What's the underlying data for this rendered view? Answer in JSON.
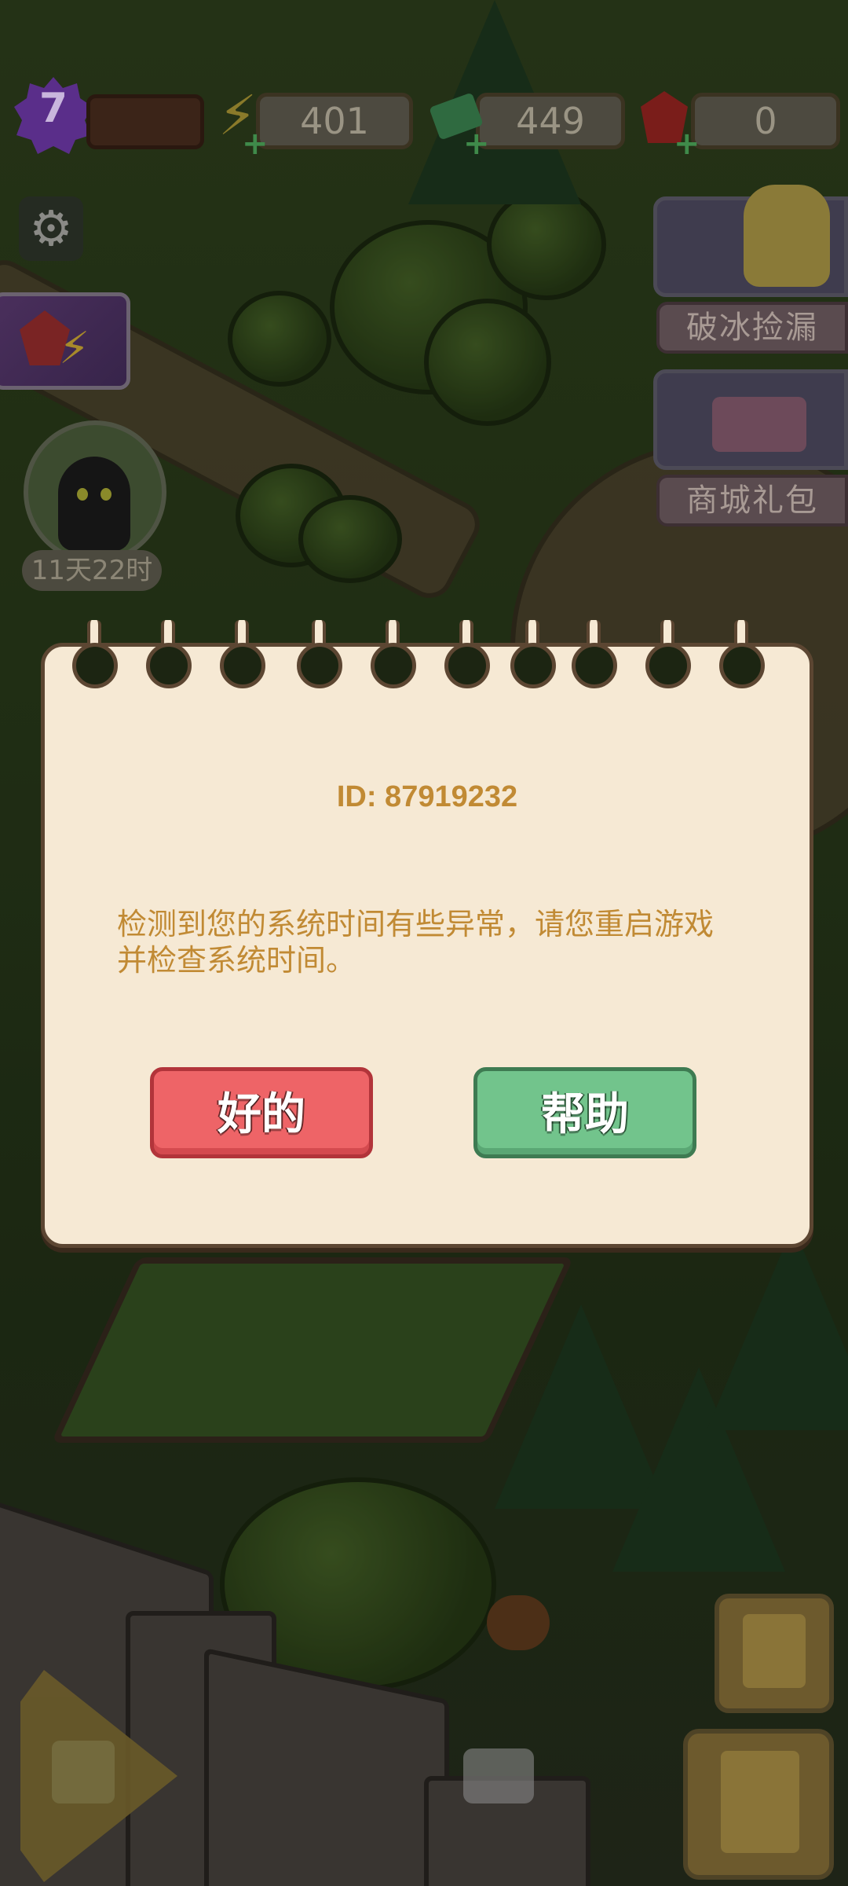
{
  "hud": {
    "level": "7",
    "energy": "401",
    "cash": "449",
    "gems": "0"
  },
  "cat_event": {
    "timer": "11天22时"
  },
  "events": [
    {
      "label": "破冰捡漏"
    },
    {
      "label": "商城礼包"
    }
  ],
  "dialog": {
    "id_text": "ID: 87919232",
    "message": "检测到您的系统时间有些异常，请您重启游戏并检查系统时间。",
    "ok_label": "好的",
    "help_label": "帮助"
  },
  "colors": {
    "dialog_bg": "#f6e9d4",
    "dialog_text": "#c18a34",
    "ok_button": "#ee6467",
    "help_button": "#72c48c"
  }
}
